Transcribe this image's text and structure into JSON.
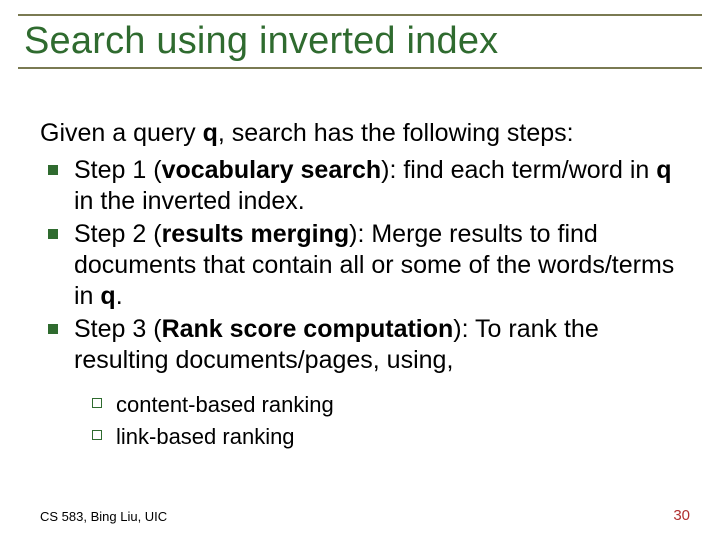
{
  "title": "Search using inverted index",
  "lead_html": "Given a query <b>q</b>, search has the following steps:",
  "steps": [
    "Step 1 (<b>vocabulary search</b>): find each term/word in <b>q</b> in the inverted index.",
    "Step 2 (<b>results merging</b>): Merge results to find documents that contain all or some of the words/terms in <b>q</b>.",
    "Step 3 (<b>Rank score computation</b>): To rank the resulting documents/pages, using,"
  ],
  "sub": [
    "content-based ranking",
    "link-based ranking"
  ],
  "footer_left": "CS 583, Bing Liu, UIC",
  "footer_right": "30"
}
